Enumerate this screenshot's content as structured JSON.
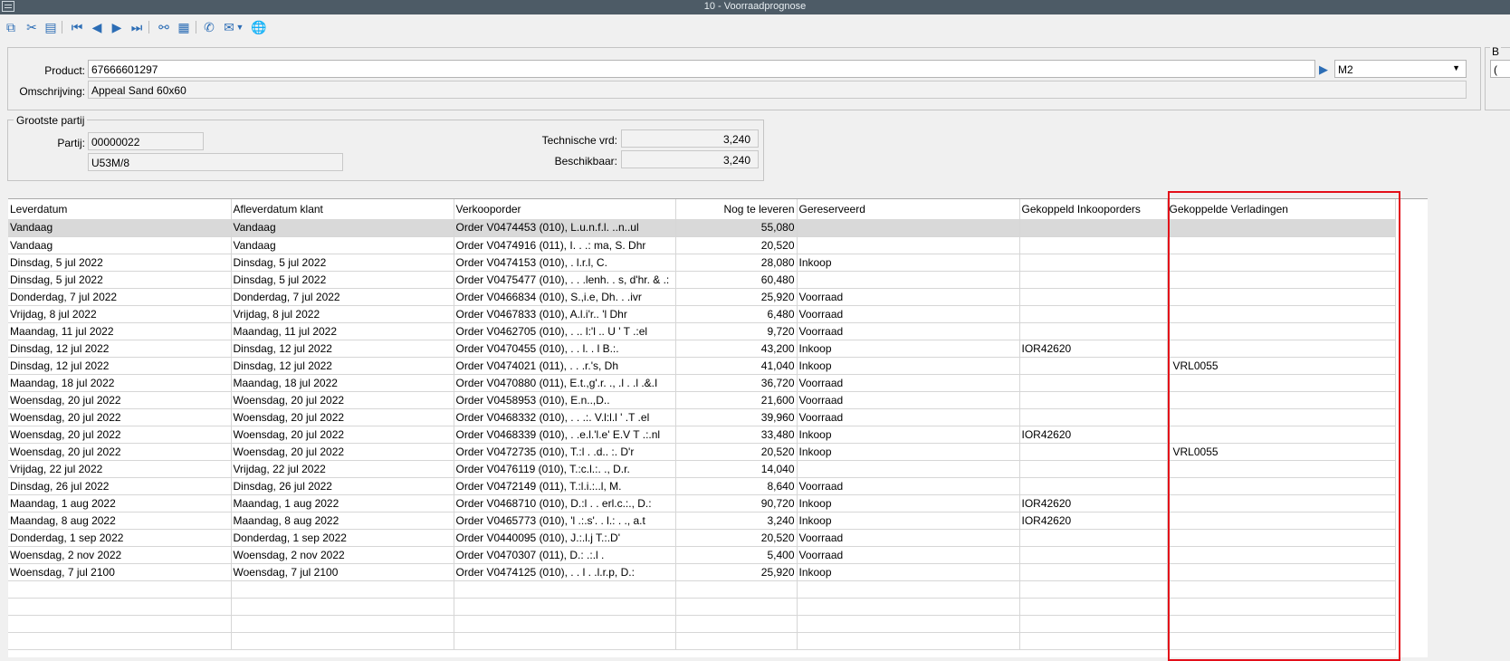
{
  "window": {
    "title": "10 - Voorraadprognose"
  },
  "toolbar": {
    "icons": [
      "copy-icon",
      "cut-icon",
      "paste-icon",
      "first-record-icon",
      "previous-record-icon",
      "next-record-icon",
      "last-record-icon",
      "binoculars-icon",
      "grid-icon",
      "phone-icon",
      "mail-icon",
      "dropdown-arrow-icon",
      "globe-icon"
    ]
  },
  "product": {
    "product_label": "Product:",
    "product_value": "67666601297",
    "unit_value": "M2",
    "omschrijving_label": "Omschrijving:",
    "omschrijving_value": "Appeal Sand 60x60",
    "side_label": "B",
    "side_value": "("
  },
  "grootste_partij": {
    "title": "Grootste partij",
    "partij_label": "Partij:",
    "partij_value": "00000022",
    "partij_sub": "U53M/8",
    "technische_label": "Technische vrd:",
    "technische_value": "3,240",
    "beschikbaar_label": "Beschikbaar:",
    "beschikbaar_value": "3,240"
  },
  "grid": {
    "headers": [
      "Leverdatum",
      "Afleverdatum klant",
      "Verkooporder",
      "Nog te leveren",
      "Gereserveerd",
      "Gekoppeld Inkooporders",
      "Gekoppelde Verladingen"
    ],
    "rows": [
      [
        "Vandaag",
        "Vandaag",
        "Order V0474453 (010), L.u.n.f.l. ..n..ul",
        "55,080",
        "",
        "",
        ""
      ],
      [
        "Vandaag",
        "Vandaag",
        "Order V0474916 (011), I. . .: ma, S. Dhr",
        "20,520",
        "",
        "",
        ""
      ],
      [
        "Dinsdag, 5 jul 2022",
        "Dinsdag, 5 jul 2022",
        "Order V0474153 (010), . l.r.l, C.",
        "28,080",
        "Inkoop",
        "",
        ""
      ],
      [
        "Dinsdag, 5 jul 2022",
        "Dinsdag, 5 jul 2022",
        "Order V0475477 (010), . . .lenh. . s, d'hr. & .:",
        "60,480",
        "",
        "",
        ""
      ],
      [
        "Donderdag, 7 jul 2022",
        "Donderdag, 7 jul 2022",
        "Order V0466834 (010), S.,i.e, Dh. . .ivr",
        "25,920",
        "Voorraad",
        "",
        ""
      ],
      [
        "Vrijdag, 8 jul 2022",
        "Vrijdag, 8 jul 2022",
        "Order V0467833 (010), A.l.i'r.. 'l Dhr",
        "6,480",
        "Voorraad",
        "",
        ""
      ],
      [
        "Maandag, 11 jul 2022",
        "Maandag, 11 jul 2022",
        "Order V0462705 (010), . .. l:'l .. U ' T .:el",
        "9,720",
        "Voorraad",
        "",
        ""
      ],
      [
        "Dinsdag, 12 jul 2022",
        "Dinsdag, 12 jul 2022",
        "Order V0470455 (010), . . l. . l B.:.",
        "43,200",
        "Inkoop",
        "IOR42620",
        ""
      ],
      [
        "Dinsdag, 12 jul 2022",
        "Dinsdag, 12 jul 2022",
        "Order V0474021 (011), . . .r.'s, Dh",
        "41,040",
        "Inkoop",
        "",
        "VRL0055"
      ],
      [
        "Maandag, 18 jul 2022",
        "Maandag, 18 jul 2022",
        "Order V0470880 (011), E.t.,g'.r. ., .l . .l .&.I",
        "36,720",
        "Voorraad",
        "",
        ""
      ],
      [
        "Woensdag, 20 jul 2022",
        "Woensdag, 20 jul 2022",
        "Order V0458953 (010), E.n..,D..",
        "21,600",
        "Voorraad",
        "",
        ""
      ],
      [
        "Woensdag, 20 jul 2022",
        "Woensdag, 20 jul 2022",
        "Order V0468332 (010), . . .:. V.l:l.l ' .T .el",
        "39,960",
        "Voorraad",
        "",
        ""
      ],
      [
        "Woensdag, 20 jul 2022",
        "Woensdag, 20 jul 2022",
        "Order V0468339 (010), . .e.l.'l.e' E.V T .:.nl",
        "33,480",
        "Inkoop",
        "IOR42620",
        ""
      ],
      [
        "Woensdag, 20 jul 2022",
        "Woensdag, 20 jul 2022",
        "Order V0472735 (010), T.:l . .d.. :. D'r",
        "20,520",
        "Inkoop",
        "",
        "VRL0055"
      ],
      [
        "Vrijdag, 22 jul 2022",
        "Vrijdag, 22 jul 2022",
        "Order V0476119 (010), T.:c.l.:. ., D.r.",
        "14,040",
        "",
        "",
        ""
      ],
      [
        "Dinsdag, 26 jul 2022",
        "Dinsdag, 26 jul 2022",
        "Order V0472149 (011), T.:l.i.:..l, M.",
        "8,640",
        "Voorraad",
        "",
        ""
      ],
      [
        "Maandag, 1 aug 2022",
        "Maandag, 1 aug 2022",
        "Order V0468710 (010), D.:l . . erl.c.:., D.:",
        "90,720",
        "Inkoop",
        "IOR42620",
        ""
      ],
      [
        "Maandag, 8 aug 2022",
        "Maandag, 8 aug 2022",
        "Order V0465773 (010), 'l .:.s'. . l.: . ., a.t",
        "3,240",
        "Inkoop",
        "IOR42620",
        ""
      ],
      [
        "Donderdag, 1 sep 2022",
        "Donderdag, 1 sep 2022",
        "Order V0440095 (010), J.:.l.j T.:.D'",
        "20,520",
        "Voorraad",
        "",
        ""
      ],
      [
        "Woensdag, 2 nov 2022",
        "Woensdag, 2 nov 2022",
        "Order V0470307 (011), D.: .:.l .",
        "5,400",
        "Voorraad",
        "",
        ""
      ],
      [
        "Woensdag, 7 jul 2100",
        "Woensdag, 7 jul 2100",
        "Order V0474125 (010), . . l . .l.r.p, D.:",
        "25,920",
        "Inkoop",
        "",
        ""
      ]
    ]
  }
}
